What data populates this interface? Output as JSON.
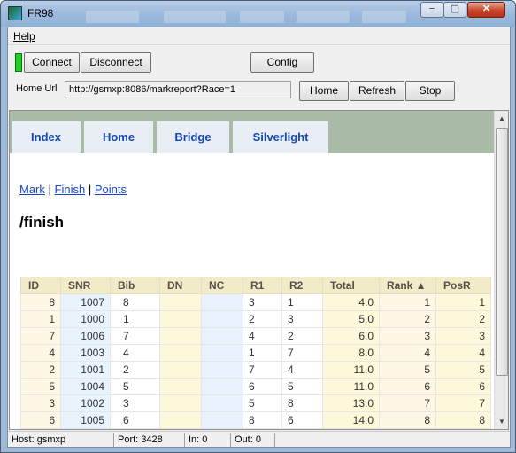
{
  "window": {
    "title": "FR98",
    "minimize_glyph": "−",
    "maximize_glyph": "▢",
    "close_glyph": "✕"
  },
  "menu": {
    "help": "Help"
  },
  "toolbar": {
    "connect": "Connect",
    "disconnect": "Disconnect",
    "config": "Config",
    "home_url_label": "Home Url",
    "home_url_value": "http://gsmxp:8086/markreport?Race=1",
    "home": "Home",
    "refresh": "Refresh",
    "stop": "Stop",
    "connection_color": "#1fd11f"
  },
  "nav": {
    "tabs": [
      "Index",
      "Home",
      "Bridge",
      "Silverlight"
    ]
  },
  "page": {
    "links": [
      "Mark",
      "Finish",
      "Points"
    ],
    "separator": "|",
    "heading": "/finish"
  },
  "table": {
    "columns": [
      "ID",
      "SNR",
      "Bib",
      "DN",
      "NC",
      "R1",
      "R2",
      "Total",
      "Rank ▲",
      "PosR"
    ],
    "rows": [
      [
        "8",
        "1007",
        "8",
        "",
        "",
        "3",
        "1",
        "4.0",
        "1",
        "1"
      ],
      [
        "1",
        "1000",
        "1",
        "",
        "",
        "2",
        "3",
        "5.0",
        "2",
        "2"
      ],
      [
        "7",
        "1006",
        "7",
        "",
        "",
        "4",
        "2",
        "6.0",
        "3",
        "3"
      ],
      [
        "4",
        "1003",
        "4",
        "",
        "",
        "1",
        "7",
        "8.0",
        "4",
        "4"
      ],
      [
        "2",
        "1001",
        "2",
        "",
        "",
        "7",
        "4",
        "11.0",
        "5",
        "5"
      ],
      [
        "5",
        "1004",
        "5",
        "",
        "",
        "6",
        "5",
        "11.0",
        "6",
        "6"
      ],
      [
        "3",
        "1002",
        "3",
        "",
        "",
        "5",
        "8",
        "13.0",
        "7",
        "7"
      ],
      [
        "6",
        "1005",
        "6",
        "",
        "",
        "8",
        "6",
        "14.0",
        "8",
        "8"
      ]
    ]
  },
  "statusbar": {
    "host": "Host: gsmxp",
    "port": "Port: 3428",
    "in": "In: 0",
    "out": "Out: 0"
  },
  "scrollbar": {
    "up": "▲",
    "down": "▼"
  }
}
